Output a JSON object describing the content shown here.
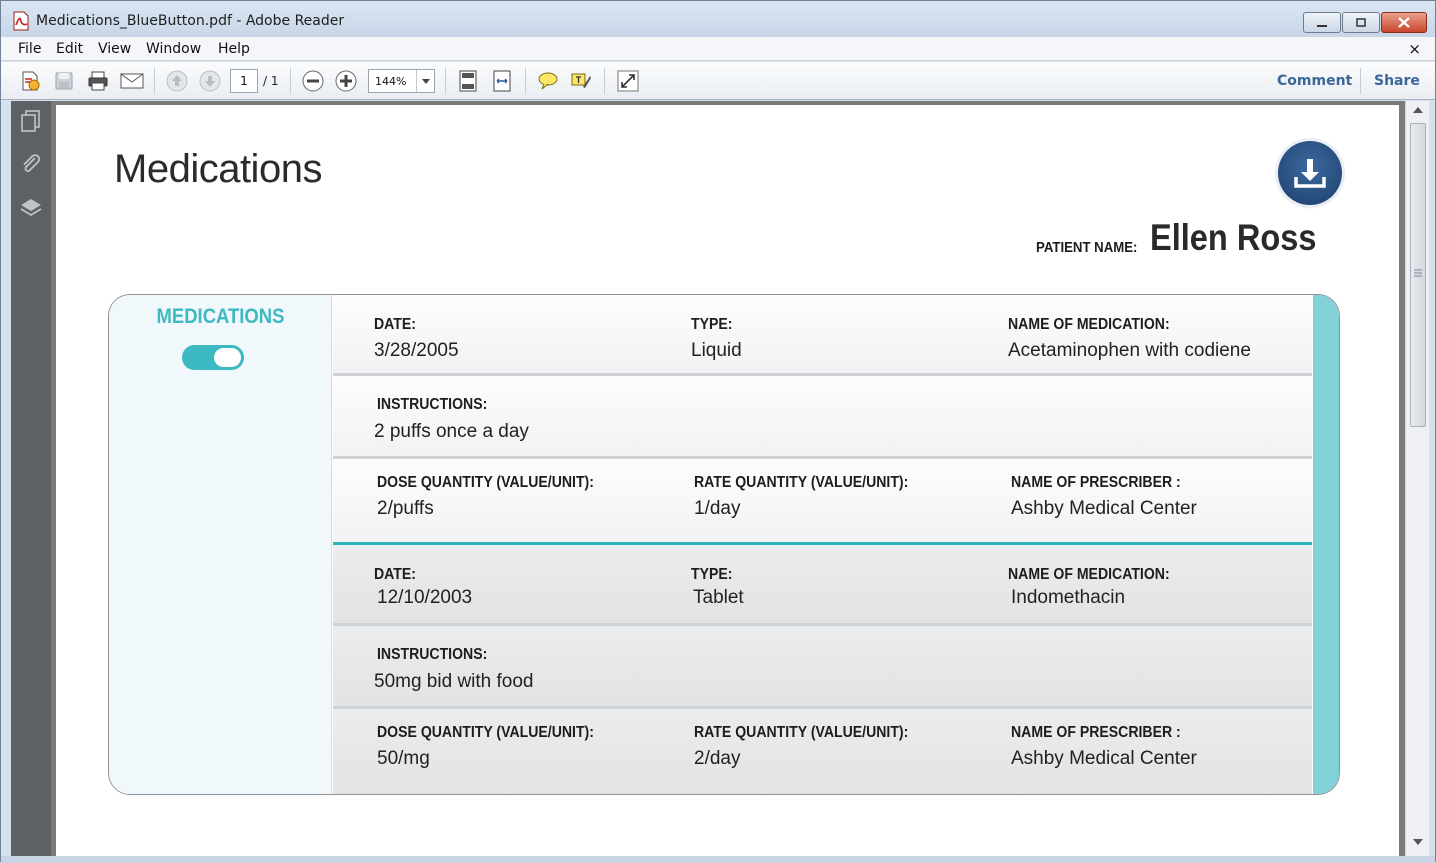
{
  "window": {
    "title": "Medications_BlueButton.pdf - Adobe Reader"
  },
  "menu": {
    "items": [
      "File",
      "Edit",
      "View",
      "Window",
      "Help"
    ],
    "close_doc": "×"
  },
  "toolbar": {
    "page_current": "1",
    "page_total": "/ 1",
    "zoom": "144%",
    "comment_label": "Comment",
    "share_label": "Share"
  },
  "document": {
    "title": "Medications",
    "patient_label": "PATIENT NAME:",
    "patient_name": "Ellen Ross",
    "section_heading": "MEDICATIONS",
    "labels": {
      "date": "DATE:",
      "type": "TYPE:",
      "name": "NAME OF MEDICATION:",
      "instructions": "INSTRUCTIONS:",
      "dose": "DOSE QUANTITY (VALUE/UNIT):",
      "rate": "RATE QUANTITY (VALUE/UNIT):",
      "prescriber": "NAME OF PRESCRIBER :"
    },
    "medications": [
      {
        "date": "3/28/2005",
        "type": "Liquid",
        "name": "Acetaminophen with codiene",
        "instructions": "2 puffs once a day",
        "dose": "2/puffs",
        "rate": "1/day",
        "prescriber": "Ashby Medical Center"
      },
      {
        "date": "12/10/2003",
        "type": "Tablet",
        "name": "Indomethacin",
        "instructions": "50mg bid with food",
        "dose": "50/mg",
        "rate": "2/day",
        "prescriber": "Ashby Medical Center"
      }
    ]
  },
  "colors": {
    "accent_teal": "#3db9c1",
    "accent_light_teal": "#82d1d8",
    "link_blue": "#3b6696",
    "download_blue": "#1c3e6b"
  }
}
